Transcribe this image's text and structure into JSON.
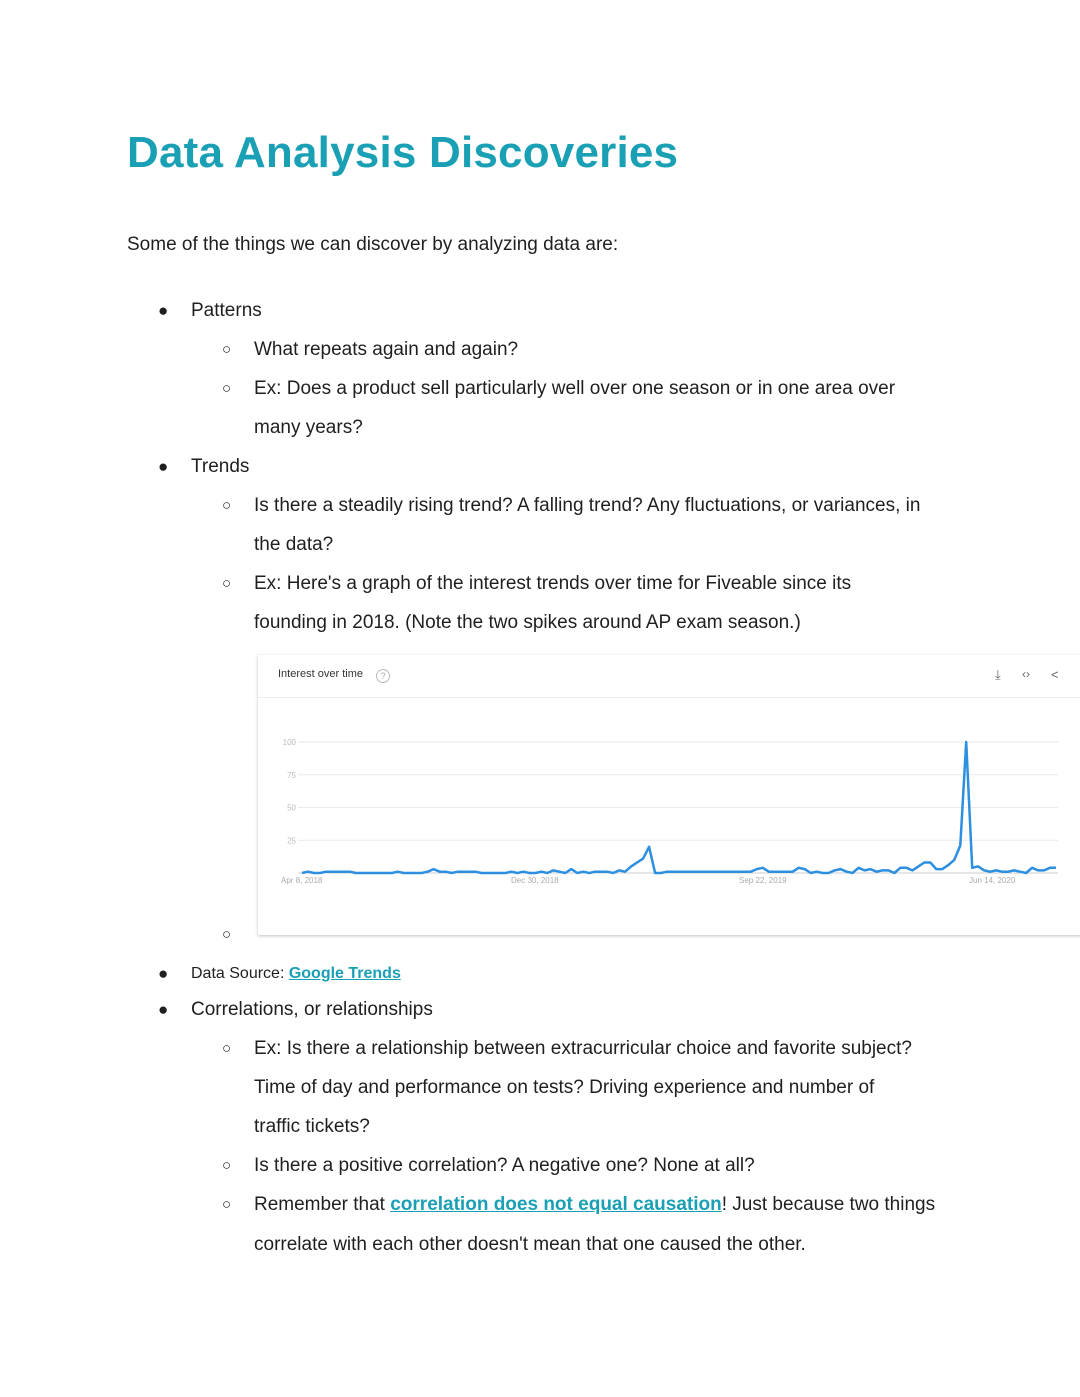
{
  "title": "Data Analysis Discoveries",
  "intro": "Some of the things we can discover by analyzing data are:",
  "bullets": {
    "patterns": "Patterns",
    "patterns_q": "What repeats again and again?",
    "patterns_ex1": "Ex: Does a product sell particularly well over one season or in one area over",
    "patterns_ex2": "many years?",
    "trends": "Trends",
    "trends_q1": "Is there a steadily rising trend? A falling trend? Any fluctuations, or variances, in",
    "trends_q2": "the data?",
    "trends_ex1": "Ex: Here's a graph of the interest trends over time for Fiveable since its",
    "trends_ex2": "founding in 2018. (Note the two spikes around AP exam season.)",
    "source_label": "Data Source: ",
    "source_link": "Google Trends",
    "corr": "Correlations, or relationships",
    "corr_ex1": "Ex: Is there a relationship between extracurricular choice and favorite subject?",
    "corr_ex2": "Time of day and performance on tests? Driving experience and number of",
    "corr_ex3": "traffic tickets?",
    "corr_q": "Is there a positive correlation? A negative one? None at all?",
    "corr_rem_pre": "Remember that ",
    "corr_rem_link": "correlation does not equal causation",
    "corr_rem_post": "! Just because two things",
    "corr_rem2": "correlate with each other doesn't mean that one caused the other."
  },
  "colors": {
    "accent": "#1aa0b4",
    "line": "#2d8fe0"
  },
  "chart_data": {
    "type": "line",
    "title": "Interest over time",
    "help_icon": "question-icon",
    "toolbar_icons": [
      "download-icon",
      "embed-code-icon",
      "share-icon"
    ],
    "x_tick_labels": [
      "Apr 8, 2018",
      "Dec 30, 2018",
      "Sep 22, 2019",
      "Jun 14, 2020"
    ],
    "y_ticks": [
      25,
      50,
      75,
      100
    ],
    "ylim": [
      0,
      100
    ],
    "grid": true,
    "x_start": "Apr 8, 2018",
    "x_interval": "weekly",
    "values": [
      0,
      1,
      0,
      0,
      1,
      1,
      1,
      1,
      1,
      0,
      0,
      0,
      0,
      0,
      0,
      0,
      1,
      0,
      0,
      0,
      0,
      1,
      3,
      1,
      1,
      0,
      1,
      1,
      1,
      1,
      0,
      0,
      0,
      0,
      0,
      1,
      0,
      1,
      0,
      0,
      1,
      0,
      2,
      1,
      0,
      3,
      0,
      1,
      0,
      1,
      1,
      1,
      0,
      2,
      1,
      5,
      8,
      11,
      20,
      0,
      0,
      1,
      1,
      1,
      1,
      1,
      1,
      1,
      1,
      1,
      1,
      1,
      1,
      1,
      1,
      1,
      3,
      4,
      1,
      1,
      1,
      1,
      1,
      4,
      3,
      0,
      1,
      0,
      0,
      2,
      3,
      1,
      0,
      4,
      2,
      3,
      1,
      2,
      2,
      0,
      4,
      4,
      2,
      5,
      8,
      8,
      3,
      3,
      6,
      10,
      21,
      100,
      4,
      5,
      2,
      1,
      2,
      1,
      1,
      2,
      1,
      0,
      4,
      2,
      2,
      4,
      4
    ]
  }
}
